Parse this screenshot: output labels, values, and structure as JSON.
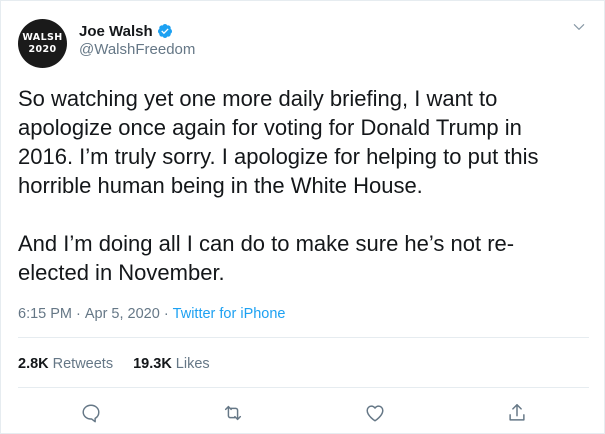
{
  "author": {
    "avatar_line1": "WALSH",
    "avatar_line2": "2020",
    "display_name": "Joe Walsh",
    "handle": "@WalshFreedom",
    "verified": true
  },
  "tweet": {
    "text": "So watching yet one more daily briefing, I want to\napologize once again for voting for Donald Trump in\n2016. I’m truly sorry. I apologize for helping to put this\nhorrible human being in the White House.\n\nAnd I’m doing all I can do to make sure he’s not re-\nelected in November.",
    "time": "6:15 PM",
    "date": "Apr 5, 2020",
    "separator": "·",
    "source": "Twitter for iPhone"
  },
  "stats": {
    "retweets_count": "2.8K",
    "retweets_label": "Retweets",
    "likes_count": "19.3K",
    "likes_label": "Likes"
  },
  "icons": {
    "reply": "reply-icon",
    "retweet": "retweet-icon",
    "like": "heart-icon",
    "share": "share-icon",
    "caret": "chevron-down-icon",
    "verified": "verified-badge-icon"
  },
  "colors": {
    "text": "#14171a",
    "secondary": "#657786",
    "accent": "#1da1f2",
    "border": "#e6ecf0"
  }
}
